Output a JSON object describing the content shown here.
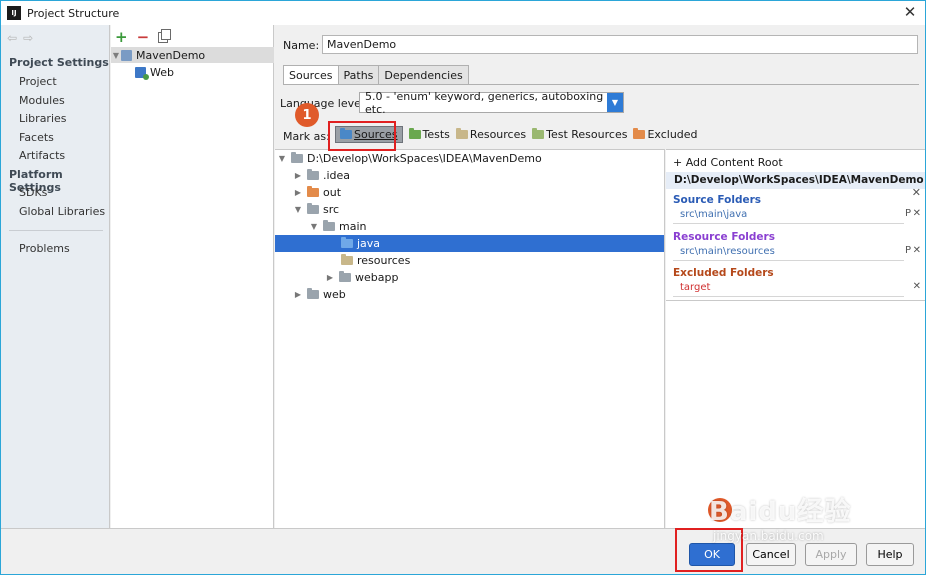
{
  "window": {
    "title": "Project Structure"
  },
  "nav": {
    "groups": [
      {
        "label": "Project Settings",
        "items": [
          "Project",
          "Modules",
          "Libraries",
          "Facets",
          "Artifacts"
        ]
      },
      {
        "label": "Platform Settings",
        "items": [
          "SDKs",
          "Global Libraries"
        ]
      }
    ],
    "extra": "Problems"
  },
  "modules": {
    "items": [
      {
        "label": "MavenDemo",
        "selected": true
      },
      {
        "label": "Web"
      }
    ]
  },
  "editor": {
    "name_label": "Name:",
    "name_value": "MavenDemo",
    "tabs": [
      "Sources",
      "Paths",
      "Dependencies"
    ],
    "active_tab": "Sources",
    "language_level_label": "Language level:",
    "language_level_value": "5.0 - 'enum' keyword, generics, autoboxing etc.",
    "mark_as_label": "Mark as:",
    "mark_as": [
      {
        "label": "Sources",
        "color": "#4a88c7"
      },
      {
        "label": "Tests",
        "color": "#6aa84f"
      },
      {
        "label": "Resources",
        "color": "#c8b78a"
      },
      {
        "label": "Test Resources",
        "color": "#9ab870"
      },
      {
        "label": "Excluded",
        "color": "#e38b4a"
      }
    ]
  },
  "annotation": {
    "badge": "1",
    "color": "#e05a2a"
  },
  "tree": [
    {
      "label": "D:\\Develop\\WorkSpaces\\IDEA\\MavenDemo",
      "depth": 0,
      "expanded": true,
      "color": "#9aa4ad"
    },
    {
      "label": ".idea",
      "depth": 1,
      "expanded": false,
      "color": "#9aa4ad"
    },
    {
      "label": "out",
      "depth": 1,
      "expanded": false,
      "color": "#e38b4a"
    },
    {
      "label": "src",
      "depth": 1,
      "expanded": true,
      "color": "#9aa4ad"
    },
    {
      "label": "main",
      "depth": 2,
      "expanded": true,
      "color": "#9aa4ad"
    },
    {
      "label": "java",
      "depth": 3,
      "selected": true,
      "color": "#4a88c7"
    },
    {
      "label": "resources",
      "depth": 3,
      "color": "#c8b78a"
    },
    {
      "label": "webapp",
      "depth": 3,
      "expanded": false,
      "color": "#9aa4ad"
    },
    {
      "label": "web",
      "depth": 1,
      "expanded": false,
      "color": "#9aa4ad"
    }
  ],
  "roots": {
    "add_label": "Add Content Root",
    "root_path": "D:\\Develop\\WorkSpaces\\IDEA\\MavenDemo",
    "source_title": "Source Folders",
    "source_path": "src\\main\\java",
    "resource_title": "Resource Folders",
    "resource_path": "src\\main\\resources",
    "excluded_title": "Excluded Folders",
    "excluded_path": "target",
    "edit_glyph": "P",
    "remove_glyph": "✕"
  },
  "buttons": {
    "ok": "OK",
    "cancel": "Cancel",
    "apply": "Apply",
    "help": "Help"
  },
  "watermark": {
    "main": "Baidu经验",
    "sub": "jingyan.baidu.com"
  }
}
